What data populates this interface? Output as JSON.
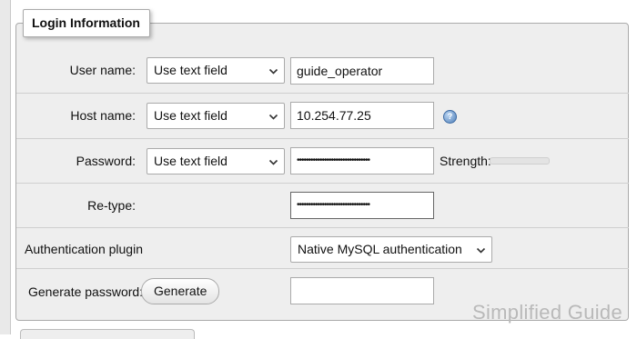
{
  "legend": "Login Information",
  "rows": {
    "username": {
      "label": "User name:",
      "select_value": "Use text field",
      "input_value": "guide_operator"
    },
    "hostname": {
      "label": "Host name:",
      "select_value": "Use text field",
      "input_value": "10.254.77.25",
      "help_icon": "help-icon"
    },
    "password": {
      "label": "Password:",
      "select_value": "Use text field",
      "input_value": "••••••••••••••••••••••••••••••••",
      "strength_label": "Strength:"
    },
    "retype": {
      "label": "Re-type:",
      "input_value": "••••••••••••••••••••••••••••••••"
    },
    "auth_plugin": {
      "label": "Authentication plugin",
      "select_value": "Native MySQL authentication"
    },
    "generate": {
      "label": "Generate password:",
      "button_label": "Generate",
      "input_value": ""
    }
  },
  "watermark": "Simplified Guide"
}
